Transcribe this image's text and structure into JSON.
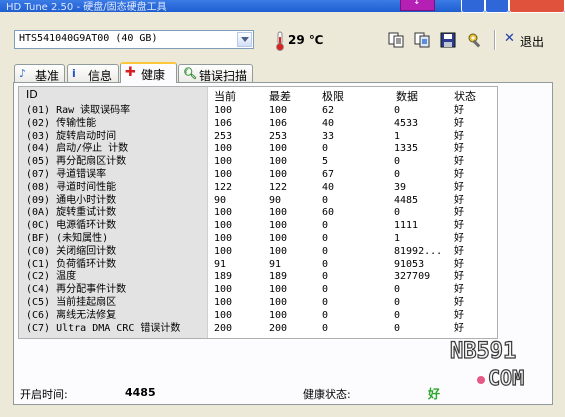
{
  "window": {
    "title": "HD Tune 2.50 - 硬盘/固态硬盘工具",
    "special_button_label": "↓"
  },
  "toolbar": {
    "drive": "HTS541040G9AT00 (40 GB)",
    "temperature": "29 ℃",
    "exit_label": "退出"
  },
  "tabs": [
    {
      "label": "基准",
      "icon": "benchmark-icon"
    },
    {
      "label": "信息",
      "icon": "info-icon"
    },
    {
      "label": "健康",
      "icon": "health-cross-icon"
    },
    {
      "label": "错误扫描",
      "icon": "magnifier-icon"
    }
  ],
  "table": {
    "headers": [
      "ID",
      "当前",
      "最差",
      "极限",
      "数据",
      "状态"
    ],
    "rows": [
      [
        "(01) Raw 读取误码率",
        "100",
        "100",
        "62",
        "0",
        "好"
      ],
      [
        "(02) 传输性能",
        "106",
        "106",
        "40",
        "4533",
        "好"
      ],
      [
        "(03) 旋转启动时间",
        "253",
        "253",
        "33",
        "1",
        "好"
      ],
      [
        "(04) 启动/停止 计数",
        "100",
        "100",
        "0",
        "1335",
        "好"
      ],
      [
        "(05) 再分配扇区计数",
        "100",
        "100",
        "5",
        "0",
        "好"
      ],
      [
        "(07) 寻道错误率",
        "100",
        "100",
        "67",
        "0",
        "好"
      ],
      [
        "(08) 寻道时间性能",
        "122",
        "122",
        "40",
        "39",
        "好"
      ],
      [
        "(09) 通电小时计数",
        "90",
        "90",
        "0",
        "4485",
        "好"
      ],
      [
        "(0A) 旋转重试计数",
        "100",
        "100",
        "60",
        "0",
        "好"
      ],
      [
        "(0C) 电源循环计数",
        "100",
        "100",
        "0",
        "1111",
        "好"
      ],
      [
        "(BF) (未知属性)",
        "100",
        "100",
        "0",
        "1",
        "好"
      ],
      [
        "(C0) 关闭缩回计数",
        "100",
        "100",
        "0",
        "81992...",
        "好"
      ],
      [
        "(C1) 负荷循环计数",
        "91",
        "91",
        "0",
        "91053",
        "好"
      ],
      [
        "(C2) 温度",
        "189",
        "189",
        "0",
        "327709",
        "好"
      ],
      [
        "(C4) 再分配事件计数",
        "100",
        "100",
        "0",
        "0",
        "好"
      ],
      [
        "(C5) 当前挂起扇区",
        "100",
        "100",
        "0",
        "0",
        "好"
      ],
      [
        "(C6) 离线无法修复",
        "100",
        "100",
        "0",
        "0",
        "好"
      ],
      [
        "(C7) Ultra DMA CRC 错误计数",
        "200",
        "200",
        "0",
        "0",
        "好"
      ]
    ]
  },
  "footer": {
    "uptime_label": "开启时间:",
    "uptime_value": "4485",
    "health_label": "健康状态:",
    "health_value": "好"
  },
  "watermark": {
    "line1": "NB591",
    "line2": "COM"
  }
}
